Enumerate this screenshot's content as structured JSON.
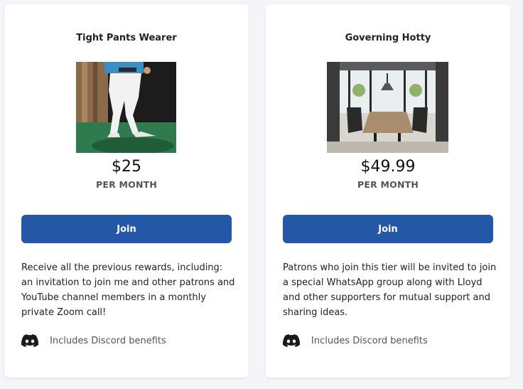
{
  "tiers": [
    {
      "title": "Tight Pants Wearer",
      "price": "$25",
      "period": "PER MONTH",
      "join_label": "Join",
      "description": "Receive all the previous rewards, including: an invitation to join me and other patrons and YouTube channel members in a monthly private Zoom call!",
      "benefit_icon": "discord-icon",
      "benefit_label": "Includes Discord benefits"
    },
    {
      "title": "Governing Hotty",
      "price": "$49.99",
      "period": "PER MONTH",
      "join_label": "Join",
      "description": "Patrons who join this tier will be invited to join a special WhatsApp group along with Lloyd and other supporters for mutual support and sharing ideas.",
      "benefit_icon": "discord-icon",
      "benefit_label": "Includes Discord benefits"
    }
  ],
  "colors": {
    "button": "#2557a7",
    "background": "#f4f5f8",
    "card": "#ffffff"
  }
}
